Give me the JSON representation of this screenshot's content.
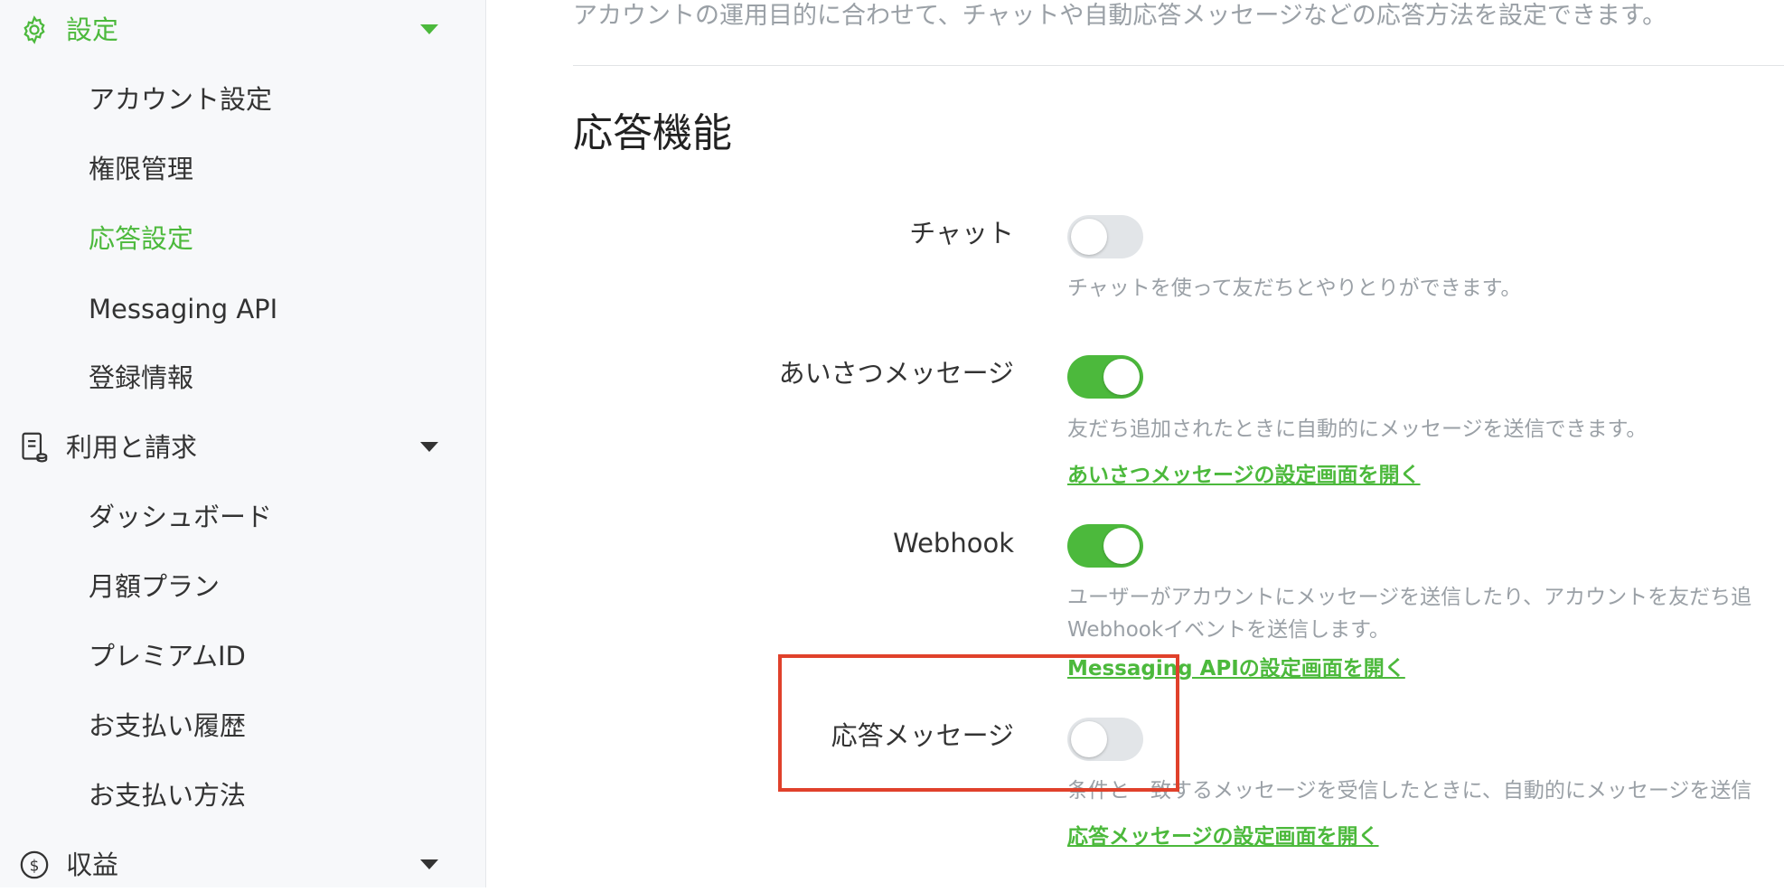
{
  "sidebar": {
    "groups": [
      {
        "label": "設定",
        "icon": "gear-icon"
      },
      {
        "label": "利用と請求",
        "icon": "billing-document-icon"
      },
      {
        "label": "収益",
        "icon": "dollar-circle-icon"
      }
    ],
    "settings_items": [
      "アカウント設定",
      "権限管理",
      "応答設定",
      "Messaging API",
      "登録情報"
    ],
    "billing_items": [
      "ダッシュボード",
      "月額プラン",
      "プレミアムID",
      "お支払い履歴",
      "お支払い方法"
    ]
  },
  "main": {
    "description": "アカウントの運用目的に合わせて、チャットや自動応答メッセージなどの応答方法を設定できます。",
    "section_title": "応答機能",
    "rows": [
      {
        "label": "チャット",
        "toggle": "off",
        "help": [
          "チャットを使って友だちとやりとりができます。"
        ],
        "link": ""
      },
      {
        "label": "あいさつメッセージ",
        "toggle": "on",
        "help": [
          "友だち追加されたときに自動的にメッセージを送信できます。"
        ],
        "link": "あいさつメッセージの設定画面を開く"
      },
      {
        "label": "Webhook",
        "toggle": "on",
        "help": [
          "ユーザーがアカウントにメッセージを送信したり、アカウントを友だち追",
          "Webhookイベントを送信します。"
        ],
        "link": "Messaging APIの設定画面を開く"
      },
      {
        "label": "応答メッセージ",
        "toggle": "off",
        "help": [
          "条件と一致するメッセージを受信したときに、自動的にメッセージを送信"
        ],
        "link": "応答メッセージの設定画面を開く"
      }
    ]
  },
  "colors": {
    "accent": "#4cb93c",
    "highlight": "#e0412b",
    "toggle_off": "#e2e5e8"
  }
}
